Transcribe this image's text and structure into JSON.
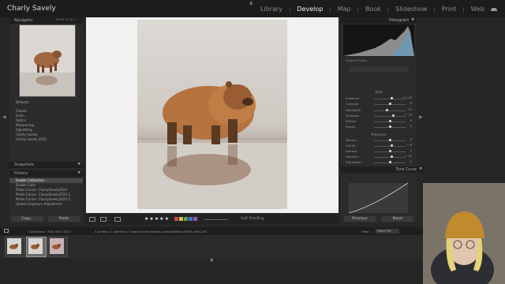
{
  "app": {
    "title": "Charly Savely"
  },
  "modules": [
    "Library",
    "Develop",
    "Map",
    "Book",
    "Slideshow",
    "Print",
    "Web"
  ],
  "active_module": "Develop",
  "left_panel": {
    "navigator_label": "Navigator",
    "navigator_zoom": "Fit  Fill  1:1  3:1",
    "presets_label": "Presets",
    "preset_groups": [
      "Defaults",
      "Classic",
      "Grain",
      "Optics",
      "Sharpening",
      "Vignetting",
      "Charly Savely",
      "Charly Savely 2024"
    ],
    "snapshots_label": "Snapshots",
    "history_label": "History",
    "history_items": [
      "Enable Calibration",
      "Enable Color",
      "Photo Corner: CharlySavely2024",
      "Photo Corner: CharlySavely2024 2",
      "Photo Corner: CharlySavely2024 3",
      "Update Exposure Adjustment"
    ],
    "copy_label": "Copy...",
    "paste_label": "Paste"
  },
  "right_panel": {
    "histogram_label": "Histogram",
    "original_photo_label": "Original Photo",
    "sliders": [
      {
        "label": "Exposure",
        "value": "+ 0.30",
        "pos": 0.55
      },
      {
        "label": "Contrast",
        "value": "0",
        "pos": 0.5
      },
      {
        "label": "Highlights",
        "value": "- 22",
        "pos": 0.4
      },
      {
        "label": "Shadows",
        "value": "+ 18",
        "pos": 0.6
      },
      {
        "label": "Whites",
        "value": "0",
        "pos": 0.5
      },
      {
        "label": "Blacks",
        "value": "0",
        "pos": 0.5
      },
      {
        "label": "Texture",
        "value": "0",
        "pos": 0.5
      },
      {
        "label": "Clarity",
        "value": "+ 8",
        "pos": 0.55
      },
      {
        "label": "Dehaze",
        "value": "0",
        "pos": 0.5
      },
      {
        "label": "Vibrance",
        "value": "+ 10",
        "pos": 0.55
      },
      {
        "label": "Saturation",
        "value": "0",
        "pos": 0.5
      }
    ],
    "tone_label": "Tone",
    "presence_label": "Presence",
    "tone_curve_label": "Tone Curve",
    "previous_label": "Previous",
    "reset_label": "Reset"
  },
  "toolbar": {
    "soft_proofing_label": "Soft Proofing"
  },
  "filmstrip": {
    "source_text": "Collections : FUN 3050 2023",
    "count_text": "3 photos / 1 selected / Charly-Savely-Katmai-coast-WildOd-00001-Edit-2.tif",
    "filter_label": "Filter :",
    "filter_value": "Filters Off",
    "thumbs": 3,
    "selected_index": 1
  }
}
